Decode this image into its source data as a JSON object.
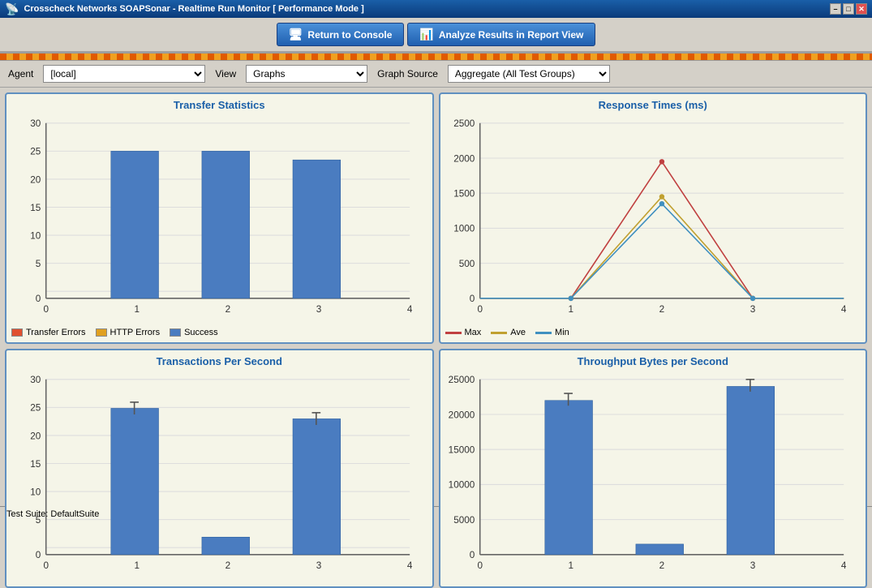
{
  "titleBar": {
    "title": "Crosscheck Networks SOAPSonar - Realtime Run Monitor [ Performance Mode ]",
    "controls": {
      "minimize": "–",
      "maximize": "□",
      "close": "✕"
    }
  },
  "toolbar": {
    "returnToConsole": "Return to Console",
    "analyzeResults": "Analyze Results in Report View"
  },
  "controls": {
    "agentLabel": "Agent",
    "agentValue": "[local]",
    "viewLabel": "View",
    "viewValue": "Graphs",
    "graphSourceLabel": "Graph Source",
    "graphSourceValue": "Aggregate (All Test Groups)"
  },
  "charts": {
    "transferStats": {
      "title": "Transfer Statistics",
      "legend": [
        {
          "label": "Transfer Errors",
          "color": "#e05030"
        },
        {
          "label": "HTTP Errors",
          "color": "#e0a020"
        },
        {
          "label": "Success",
          "color": "#4a7cc0"
        }
      ]
    },
    "responseTimes": {
      "title": "Response Times (ms)",
      "legend": [
        {
          "label": "Max",
          "color": "#c04040"
        },
        {
          "label": "Ave",
          "color": "#c0a030"
        },
        {
          "label": "Min",
          "color": "#4090c0"
        }
      ]
    },
    "transactionsPerSecond": {
      "title": "Transactions Per Second",
      "legend": []
    },
    "throughputBytes": {
      "title": "Throughput Bytes per Second",
      "legend": []
    }
  },
  "statusBar": {
    "text": "Test Suite: DefaultSuite"
  }
}
